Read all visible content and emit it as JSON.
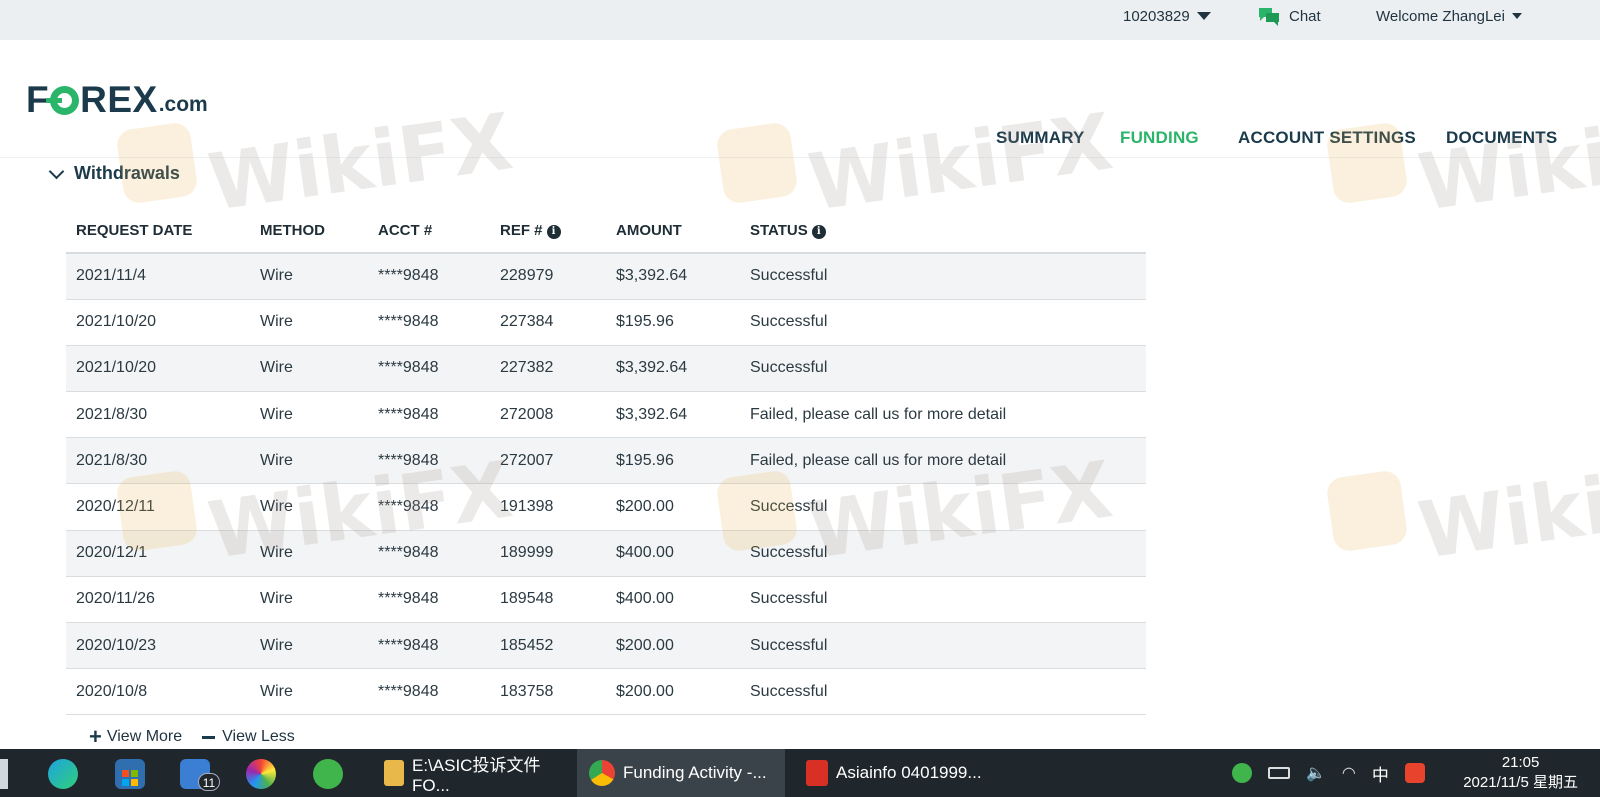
{
  "topbar": {
    "account_number": "10203829",
    "chat_label": "Chat",
    "welcome_text": "Welcome ZhangLei"
  },
  "brand": {
    "logo_main_1": "F",
    "logo_main_2": "REX",
    "logo_suffix": ".com",
    "primary_color": "#1b3a4b",
    "accent_color": "#2bb56a"
  },
  "nav": {
    "summary": "SUMMARY",
    "funding": "FUNDING",
    "account_settings": "ACCOUNT SETTINGS",
    "documents": "DOCUMENTS",
    "active": "FUNDING"
  },
  "withdrawals": {
    "section_title": "Withdrawals",
    "columns": {
      "request_date": "REQUEST DATE",
      "method": "METHOD",
      "acct": "ACCT #",
      "ref": "REF #",
      "amount": "AMOUNT",
      "status": "STATUS"
    },
    "rows": [
      {
        "date": "2021/11/4",
        "method": "Wire",
        "acct": "****9848",
        "ref": "228979",
        "amount": "$3,392.64",
        "status": "Successful"
      },
      {
        "date": "2021/10/20",
        "method": "Wire",
        "acct": "****9848",
        "ref": "227384",
        "amount": "$195.96",
        "status": "Successful"
      },
      {
        "date": "2021/10/20",
        "method": "Wire",
        "acct": "****9848",
        "ref": "227382",
        "amount": "$3,392.64",
        "status": "Successful"
      },
      {
        "date": "2021/8/30",
        "method": "Wire",
        "acct": "****9848",
        "ref": "272008",
        "amount": "$3,392.64",
        "status": "Failed, please call us for more detail"
      },
      {
        "date": "2021/8/30",
        "method": "Wire",
        "acct": "****9848",
        "ref": "272007",
        "amount": "$195.96",
        "status": "Failed, please call us for more detail"
      },
      {
        "date": "2020/12/11",
        "method": "Wire",
        "acct": "****9848",
        "ref": "191398",
        "amount": "$200.00",
        "status": "Successful"
      },
      {
        "date": "2020/12/1",
        "method": "Wire",
        "acct": "****9848",
        "ref": "189999",
        "amount": "$400.00",
        "status": "Successful"
      },
      {
        "date": "2020/11/26",
        "method": "Wire",
        "acct": "****9848",
        "ref": "189548",
        "amount": "$400.00",
        "status": "Successful"
      },
      {
        "date": "2020/10/23",
        "method": "Wire",
        "acct": "****9848",
        "ref": "185452",
        "amount": "$200.00",
        "status": "Successful"
      },
      {
        "date": "2020/10/8",
        "method": "Wire",
        "acct": "****9848",
        "ref": "183758",
        "amount": "$200.00",
        "status": "Successful"
      }
    ],
    "view_more": "View More",
    "view_less": "View Less"
  },
  "watermark": {
    "text": "WikiFX"
  },
  "taskbar": {
    "mail_badge": "11",
    "apps": [
      {
        "label": "E:\\ASIC投诉文件FO...",
        "icon": "folder-icon"
      },
      {
        "label": "Funding Activity -...",
        "icon": "chrome-icon",
        "active": true
      },
      {
        "label": "Asiainfo 0401999...",
        "icon": "pdf-icon"
      }
    ],
    "ime": "中",
    "time": "21:05",
    "date": "2021/11/5 星期五"
  }
}
